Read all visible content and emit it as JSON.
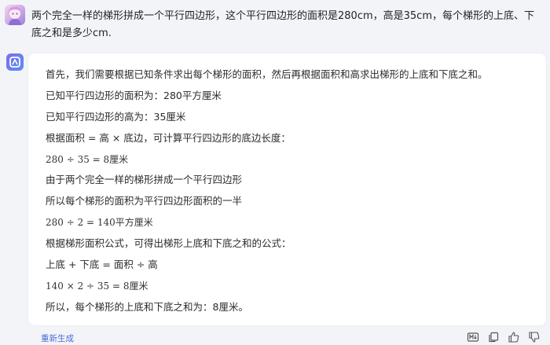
{
  "user_message": {
    "text": "两个完全一样的梯形拼成一个平行四边形，这个平行四边形的面积是280cm，高是35cm，每个梯形的上底、下底之和是多少cm."
  },
  "assistant_answer": {
    "lines": [
      "首先，我们需要根据已知条件求出每个梯形的面积，然后再根据面积和高求出梯形的上底和下底之和。",
      "已知平行四边形的面积为：280平方厘米",
      "已知平行四边形的高为：35厘米",
      "根据面积 = 高 × 底边，可计算平行四边形的底边长度：",
      "280 ÷ 35 = 8厘米",
      "由于两个完全一样的梯形拼成一个平行四边形",
      "所以每个梯形的面积为平行四边形面积的一半",
      "280 ÷ 2 = 140平方厘米",
      "根据梯形面积公式，可得出梯形上底和下底之和的公式：",
      "上底 + 下底 = 面积 ÷ 高",
      "140 × 2 ÷ 35 = 8厘米",
      "所以，每个梯形的上底和下底之和为：8厘米。"
    ]
  },
  "footer": {
    "regenerate_label": "重新生成",
    "icons": [
      "markdown-icon",
      "copy-icon",
      "thumbs-up-icon",
      "thumbs-down-icon"
    ]
  },
  "colors": {
    "accent": "#4a6bd8",
    "background": "#f3f4f8",
    "card": "#ffffff"
  }
}
